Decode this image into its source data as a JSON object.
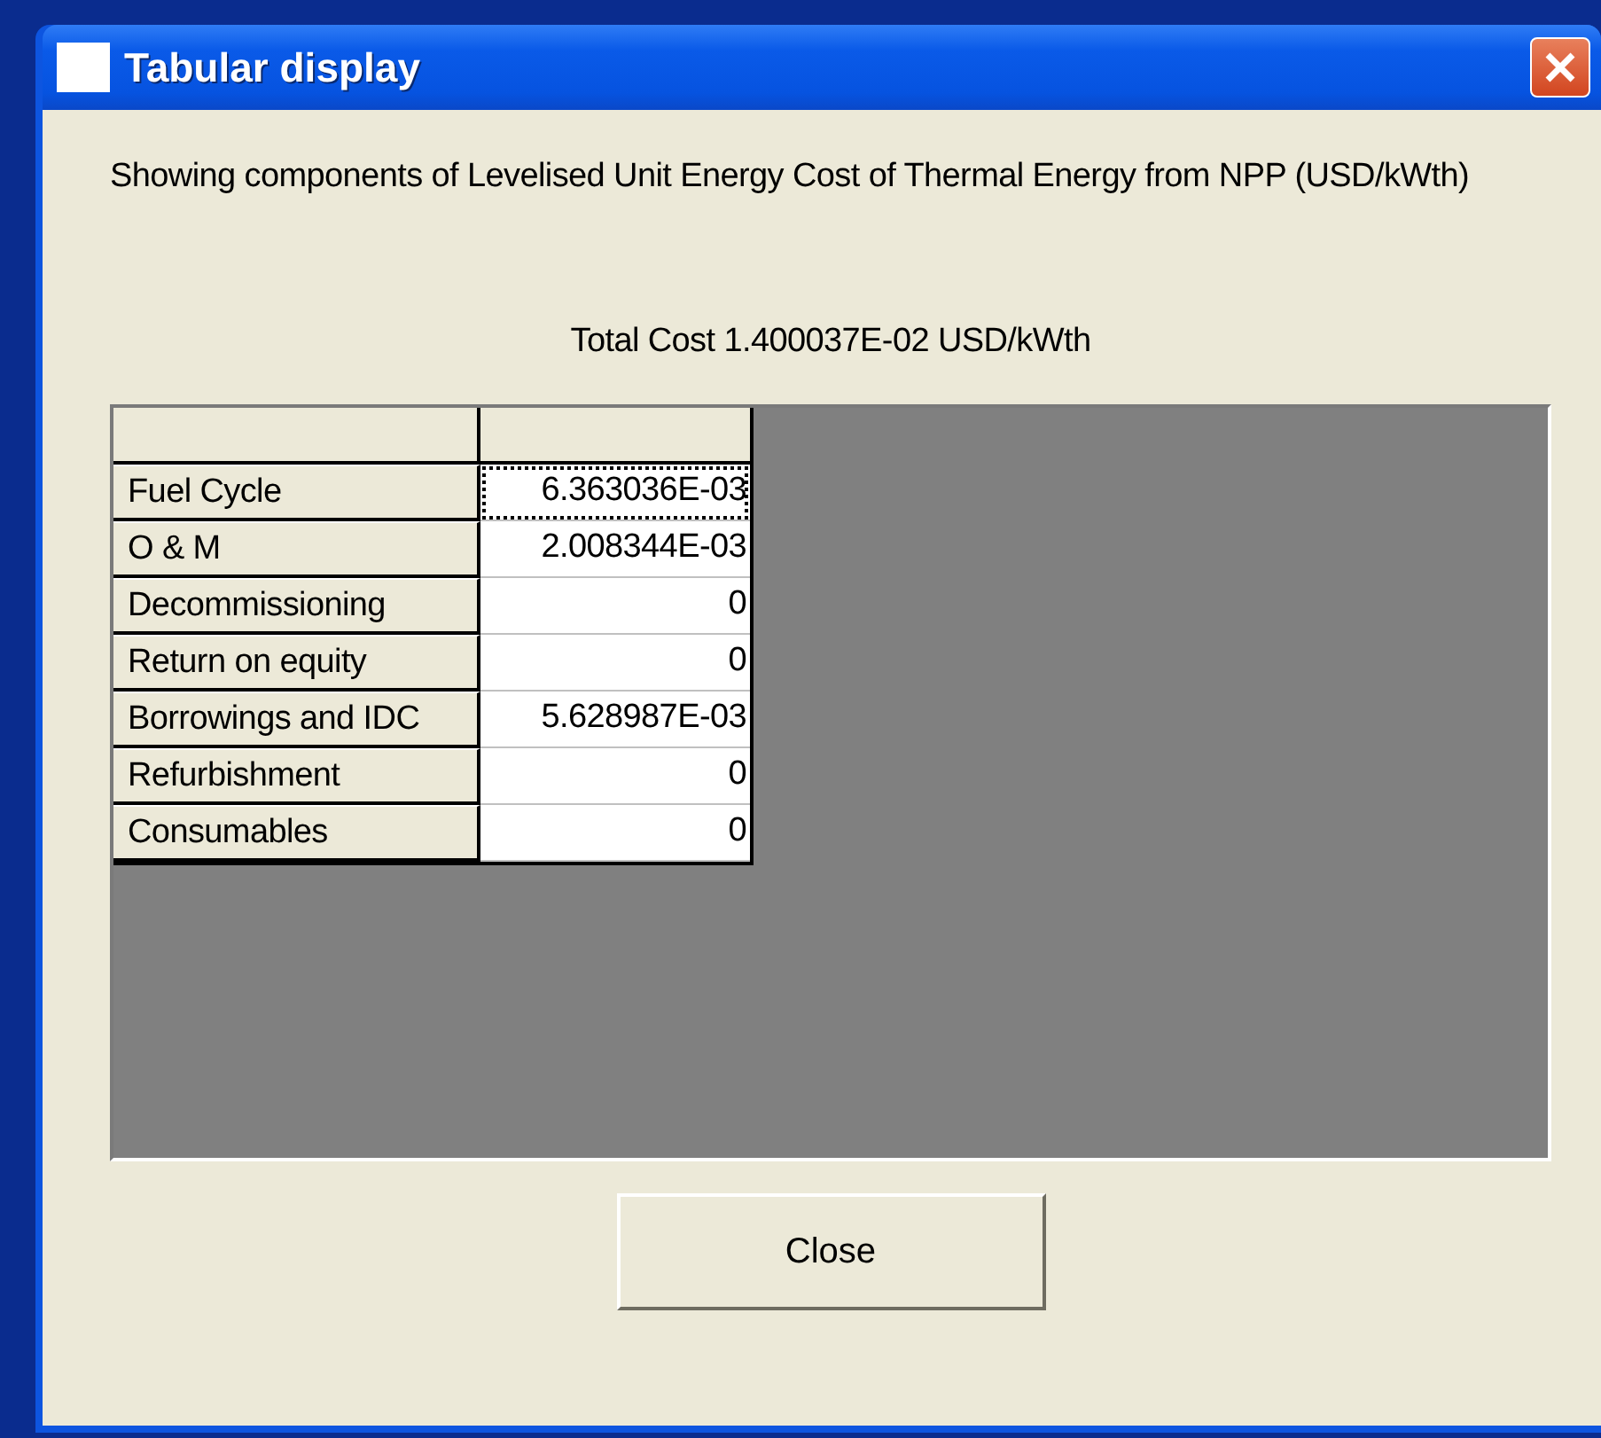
{
  "window": {
    "title": "Tabular display"
  },
  "description": "Showing components of Levelised Unit Energy Cost of Thermal Energy from NPP (USD/kWth)",
  "total": "Total Cost 1.400037E-02 USD/kWth",
  "rows": [
    {
      "label": "Fuel Cycle",
      "value": "6.363036E-03",
      "focused": true
    },
    {
      "label": "O & M",
      "value": "2.008344E-03",
      "focused": false
    },
    {
      "label": "Decommissioning",
      "value": "0",
      "focused": false
    },
    {
      "label": "Return on equity",
      "value": "0",
      "focused": false
    },
    {
      "label": "Borrowings and IDC",
      "value": "5.628987E-03",
      "focused": false
    },
    {
      "label": "Refurbishment",
      "value": "0",
      "focused": false
    },
    {
      "label": "Consumables",
      "value": "0",
      "focused": false
    }
  ],
  "buttons": [
    "Close"
  ]
}
